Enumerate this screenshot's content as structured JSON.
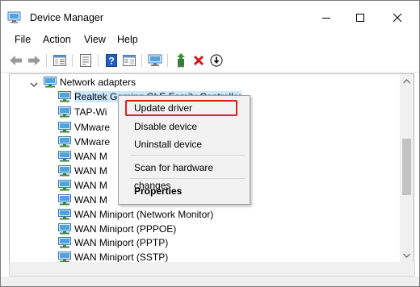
{
  "window": {
    "title": "Device Manager",
    "controls": [
      "minimize",
      "maximize",
      "close"
    ]
  },
  "menu": {
    "file": "File",
    "action": "Action",
    "view": "View",
    "help": "Help"
  },
  "toolbar": {
    "icons": [
      "back-arrow-icon",
      "forward-arrow-icon",
      "show-hide-console-tree-icon",
      "properties-icon",
      "help-icon",
      "action-pane-icon",
      "monitor-icon",
      "update-driver-icon",
      "uninstall-icon",
      "download-icon"
    ]
  },
  "tree": {
    "category": "Network adapters",
    "items": [
      "Realtek Gaming GbE Family Controller",
      "TAP-Wi",
      "VMware",
      "VMware",
      "WAN M",
      "WAN M",
      "WAN M",
      "WAN M",
      "WAN Miniport (Network Monitor)",
      "WAN Miniport (PPPOE)",
      "WAN Miniport (PPTP)",
      "WAN Miniport (SSTP)"
    ]
  },
  "context_menu": {
    "update_driver": "Update driver",
    "disable_device": "Disable device",
    "uninstall_device": "Uninstall device",
    "scan": "Scan for hardware changes",
    "properties": "Properties"
  },
  "colors": {
    "highlight_border": "#e0201c",
    "selection": "#cce8ff"
  }
}
